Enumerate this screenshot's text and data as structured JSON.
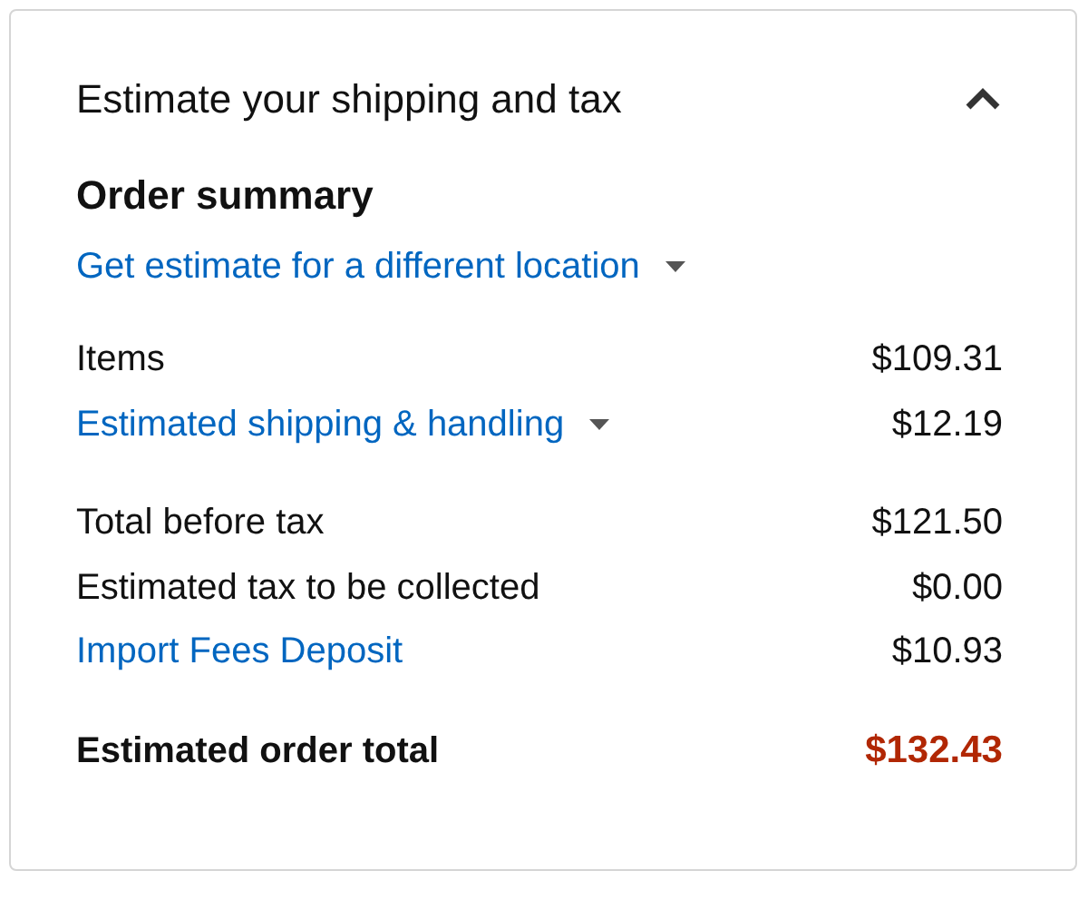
{
  "panel": {
    "title": "Estimate your shipping and tax",
    "expanded": true
  },
  "order_summary": {
    "title": "Order summary",
    "location_link": "Get estimate for a different location",
    "groups": [
      [
        {
          "kind": "plain",
          "label": "Items",
          "value": "$109.31"
        },
        {
          "kind": "dropdown-link",
          "label": "Estimated shipping & handling",
          "value": "$12.19"
        }
      ],
      [
        {
          "kind": "plain",
          "label": "Total before tax",
          "value": "$121.50"
        },
        {
          "kind": "plain",
          "label": "Estimated tax to be collected",
          "value": "$0.00"
        },
        {
          "kind": "link",
          "label": "Import Fees Deposit",
          "value": "$10.93"
        }
      ],
      [
        {
          "kind": "total",
          "label": "Estimated order total",
          "value": "$132.43"
        }
      ]
    ]
  }
}
